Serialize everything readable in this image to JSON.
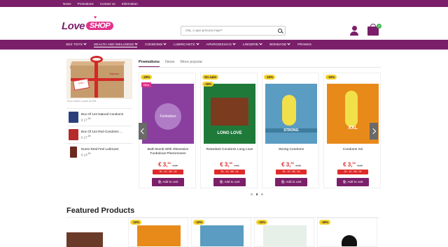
{
  "topbar": {
    "links": [
      "News",
      "Promotions",
      "Contact us",
      "Information"
    ]
  },
  "header": {
    "logo_text": "Love",
    "logo_shop": "SHOP",
    "search_placeholder": "Olá, o que procura hoje?",
    "cart_count": "0"
  },
  "nav": {
    "items": [
      {
        "label": "SEX TOYS",
        "dropdown": true
      },
      {
        "label": "HEALTH AND WELLNESS",
        "dropdown": true,
        "active": true
      },
      {
        "label": "CONDOMS",
        "dropdown": true
      },
      {
        "label": "LUBRICANTS",
        "dropdown": true
      },
      {
        "label": "APHRODISIACS",
        "dropdown": true
      },
      {
        "label": "LINGERIE",
        "dropdown": true
      },
      {
        "label": "BONDAGE",
        "dropdown": true
      },
      {
        "label": "PRANKS",
        "dropdown": false
      }
    ]
  },
  "promo": {
    "tag_text": "Grátis",
    "tag_text2": "Surpresa",
    "note": "Novo brinde a partir de 49€"
  },
  "sidebar_products": [
    {
      "name": "Box Of 144 Natural Condoms",
      "price": "€ 17",
      "price_sup": ",50",
      "color": "#2d3f7a"
    },
    {
      "name": "Box Of 144 Red Condoms ...",
      "price": "€ 17",
      "price_sup": ",50",
      "color": "#b52a2a"
    },
    {
      "name": "Durex Real Feel Lubricant",
      "price": "€ 13",
      "price_sup": ",50",
      "color": "#6b2a1e"
    }
  ],
  "tabs": [
    {
      "label": "Promotions",
      "active": true
    },
    {
      "label": "News",
      "active": false
    },
    {
      "label": "More popular",
      "active": false
    }
  ],
  "carousel_products": [
    {
      "badge": "-20%",
      "badge2": "New",
      "name": "Bath Bomb With Obsessive Funbolous Pheromones",
      "price": "€ 3,",
      "price_sup": "50",
      "old": "4,38",
      "timer": "3h : 10 : 58 : 04",
      "btn": "Add to cart",
      "img_color": "#8a3f9f",
      "brand": "Funbolous"
    },
    {
      "badge": "On sale!",
      "badge2": "-15%",
      "name": "Retardant Condoms Long Love",
      "price": "€ 3,",
      "price_sup": "50",
      "old": "4,11",
      "timer": "3h : 10 : 58 : 04",
      "btn": "Add to cart",
      "img_color": "#1f7a3a",
      "brand": "LONG LOVE"
    },
    {
      "badge": "-10%",
      "badge2": "",
      "name": "Strong Condoms",
      "price": "€ 3,",
      "price_sup": "50",
      "old": "3,88",
      "timer": "3h : 10 : 58 : 04",
      "btn": "Add to cart",
      "img_color": "#5b9cc2",
      "brand": "STRONG"
    },
    {
      "badge": "-10%",
      "badge2": "",
      "name": "Condoms Xxl",
      "price": "€ 3,",
      "price_sup": "50",
      "old": "3,88",
      "timer": "3h : 10 : 58 : 04",
      "btn": "Add to cart",
      "img_color": "#e88a1a",
      "brand": "XXL"
    }
  ],
  "featured": {
    "title": "Featured Products",
    "badges": [
      "-10%",
      "-10%",
      "-10%",
      "-30%"
    ]
  },
  "colors": {
    "brand": "#7b1f6a",
    "accent": "#e2338c",
    "sale": "#e02a2a",
    "badge": "#f4d22f"
  }
}
